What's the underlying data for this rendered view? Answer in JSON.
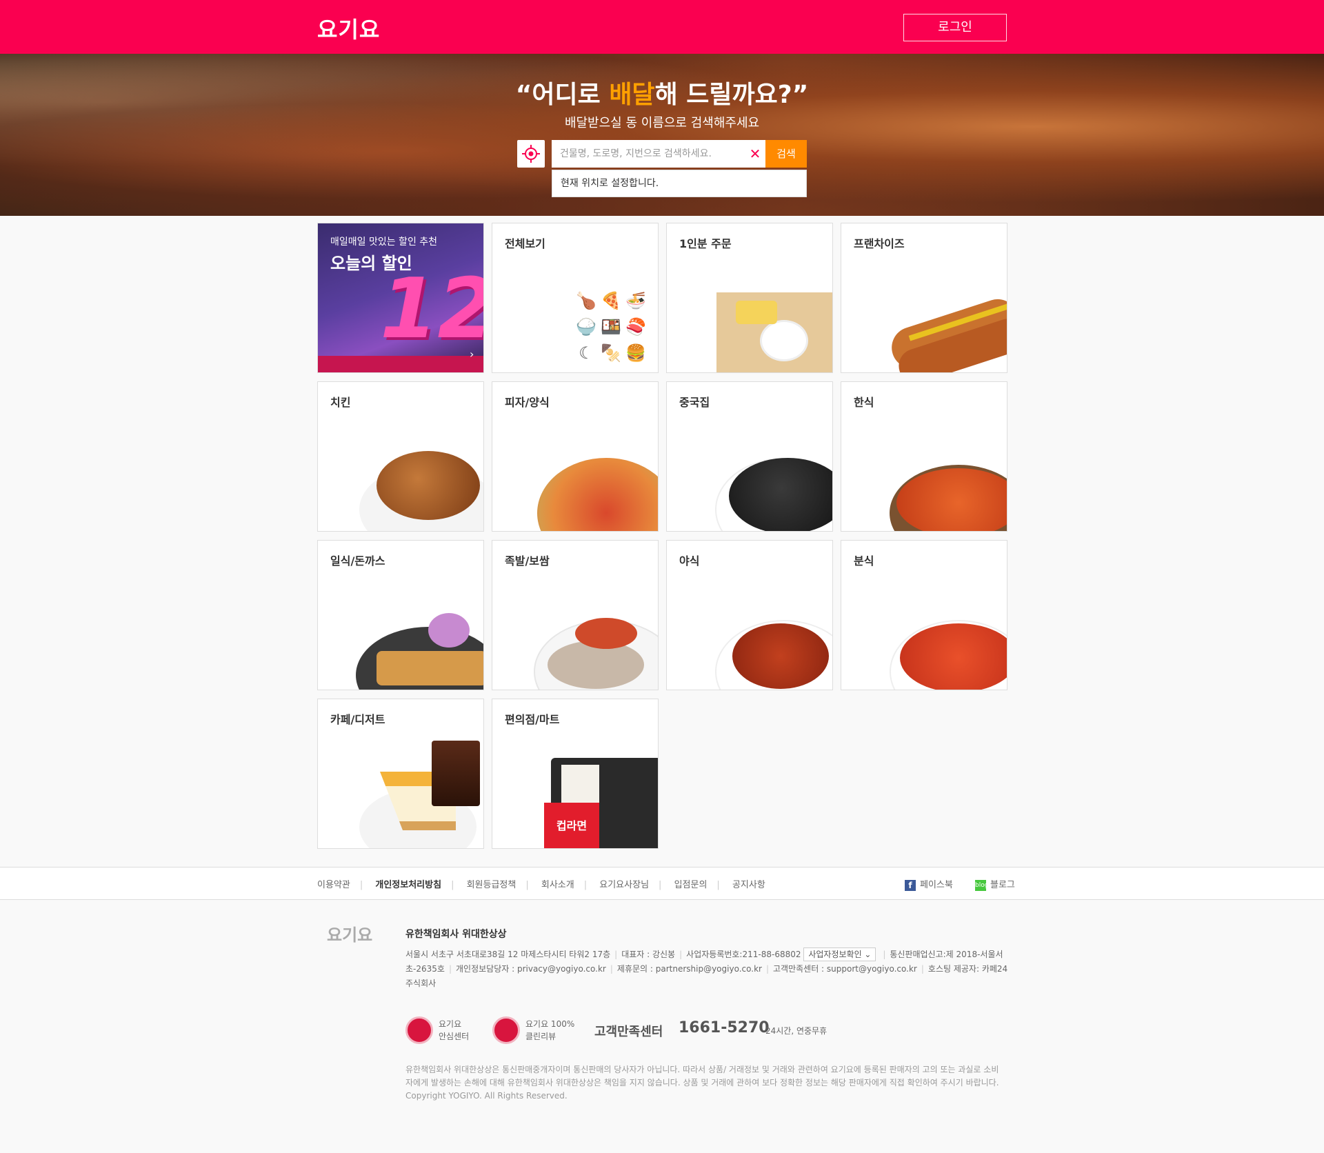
{
  "header": {
    "logo": "요기요",
    "login_label": "로그인"
  },
  "hero": {
    "title_open": "“어디로 ",
    "title_accent": "배달",
    "title_close": "해 드릴까요?”",
    "subtitle": "배달받으실 동 이름으로 검색해주세요",
    "search_placeholder": "건물명, 도로명, 지번으로 검색하세요.",
    "search_value": "",
    "clear_label": "✕",
    "search_label": "검색",
    "current_location_label": "현재 위치로 설정합니다."
  },
  "promo": {
    "line1": "매일매일 맛있는 할인 추천",
    "line2": "오늘의 할인",
    "number": "12",
    "arrow": "›"
  },
  "categories": [
    {
      "label": "전체보기"
    },
    {
      "label": "1인분 주문"
    },
    {
      "label": "프랜차이즈"
    },
    {
      "label": "치킨"
    },
    {
      "label": "피자/양식"
    },
    {
      "label": "중국집"
    },
    {
      "label": "한식"
    },
    {
      "label": "일식/돈까스"
    },
    {
      "label": "족발/보쌈"
    },
    {
      "label": "야식"
    },
    {
      "label": "분식"
    },
    {
      "label": "카페/디저트"
    },
    {
      "label": "편의점/마트"
    }
  ],
  "convenience_sign": "컵라면",
  "category_icons": [
    "chicken-icon",
    "pizza-icon",
    "noodle-bowl-icon",
    "rice-bowl-icon",
    "bento-icon",
    "sushi-icon",
    "moon-icon",
    "skewer-icon",
    "burger-icon"
  ],
  "footer_links": [
    "이용약관",
    "개인정보처리방침",
    "회원등급정책",
    "회사소개",
    "요기요사장님",
    "입점문의",
    "공지사항"
  ],
  "social": {
    "facebook": "페이스북",
    "blog": "블로그",
    "blog_mark": "blog"
  },
  "footer": {
    "logo": "요기요",
    "company": "유한책임회사 위대한상상",
    "address": "서울시 서초구 서초대로38길 12 마제스타시티 타워2 17층",
    "ceo": "대표자 : 강신봉",
    "biz_no": "사업자등록번호:211-88-68802",
    "biz_check": "사업자정보확인",
    "mail_order": "통신판매업신고:제 2018-서울서초-2635호",
    "privacy": "개인정보담당자 : privacy@yogiyo.co.kr",
    "partnership": "제휴문의 : partnership@yogiyo.co.kr",
    "support": "고객만족센터 : support@yogiyo.co.kr",
    "hosting": "호스팅 제공자: 카페24 주식회사",
    "badge1_line1": "요기요",
    "badge1_line2": "안심센터",
    "badge2_line1": "요기요 100%",
    "badge2_line2": "클린리뷰",
    "cs_title": "고객만족센터",
    "cs_phone": "1661-5270",
    "cs_hours": "24시간, 연중무휴",
    "disclaimer": "유한책임회사 위대한상상은 통신판매중개자이며 통신판매의 당사자가 아닙니다. 따라서 상품/ 거래정보 및 거래와 관련하여 요기요에 등록된 판매자의 고의 또는 과실로 소비자에게 발생하는 손해에 대해 유한책임회사 위대한상상은 책임을 지지 않습니다. 상품 및 거래에 관하여 보다 정확한 정보는 해당 판매자에게 직접 확인하여 주시기 바랍니다. Copyright YOGIYO. All Rights Reserved."
  },
  "colors": {
    "brand": "#fa0050",
    "accent": "#ffa000",
    "search_button": "#ff8a00"
  }
}
